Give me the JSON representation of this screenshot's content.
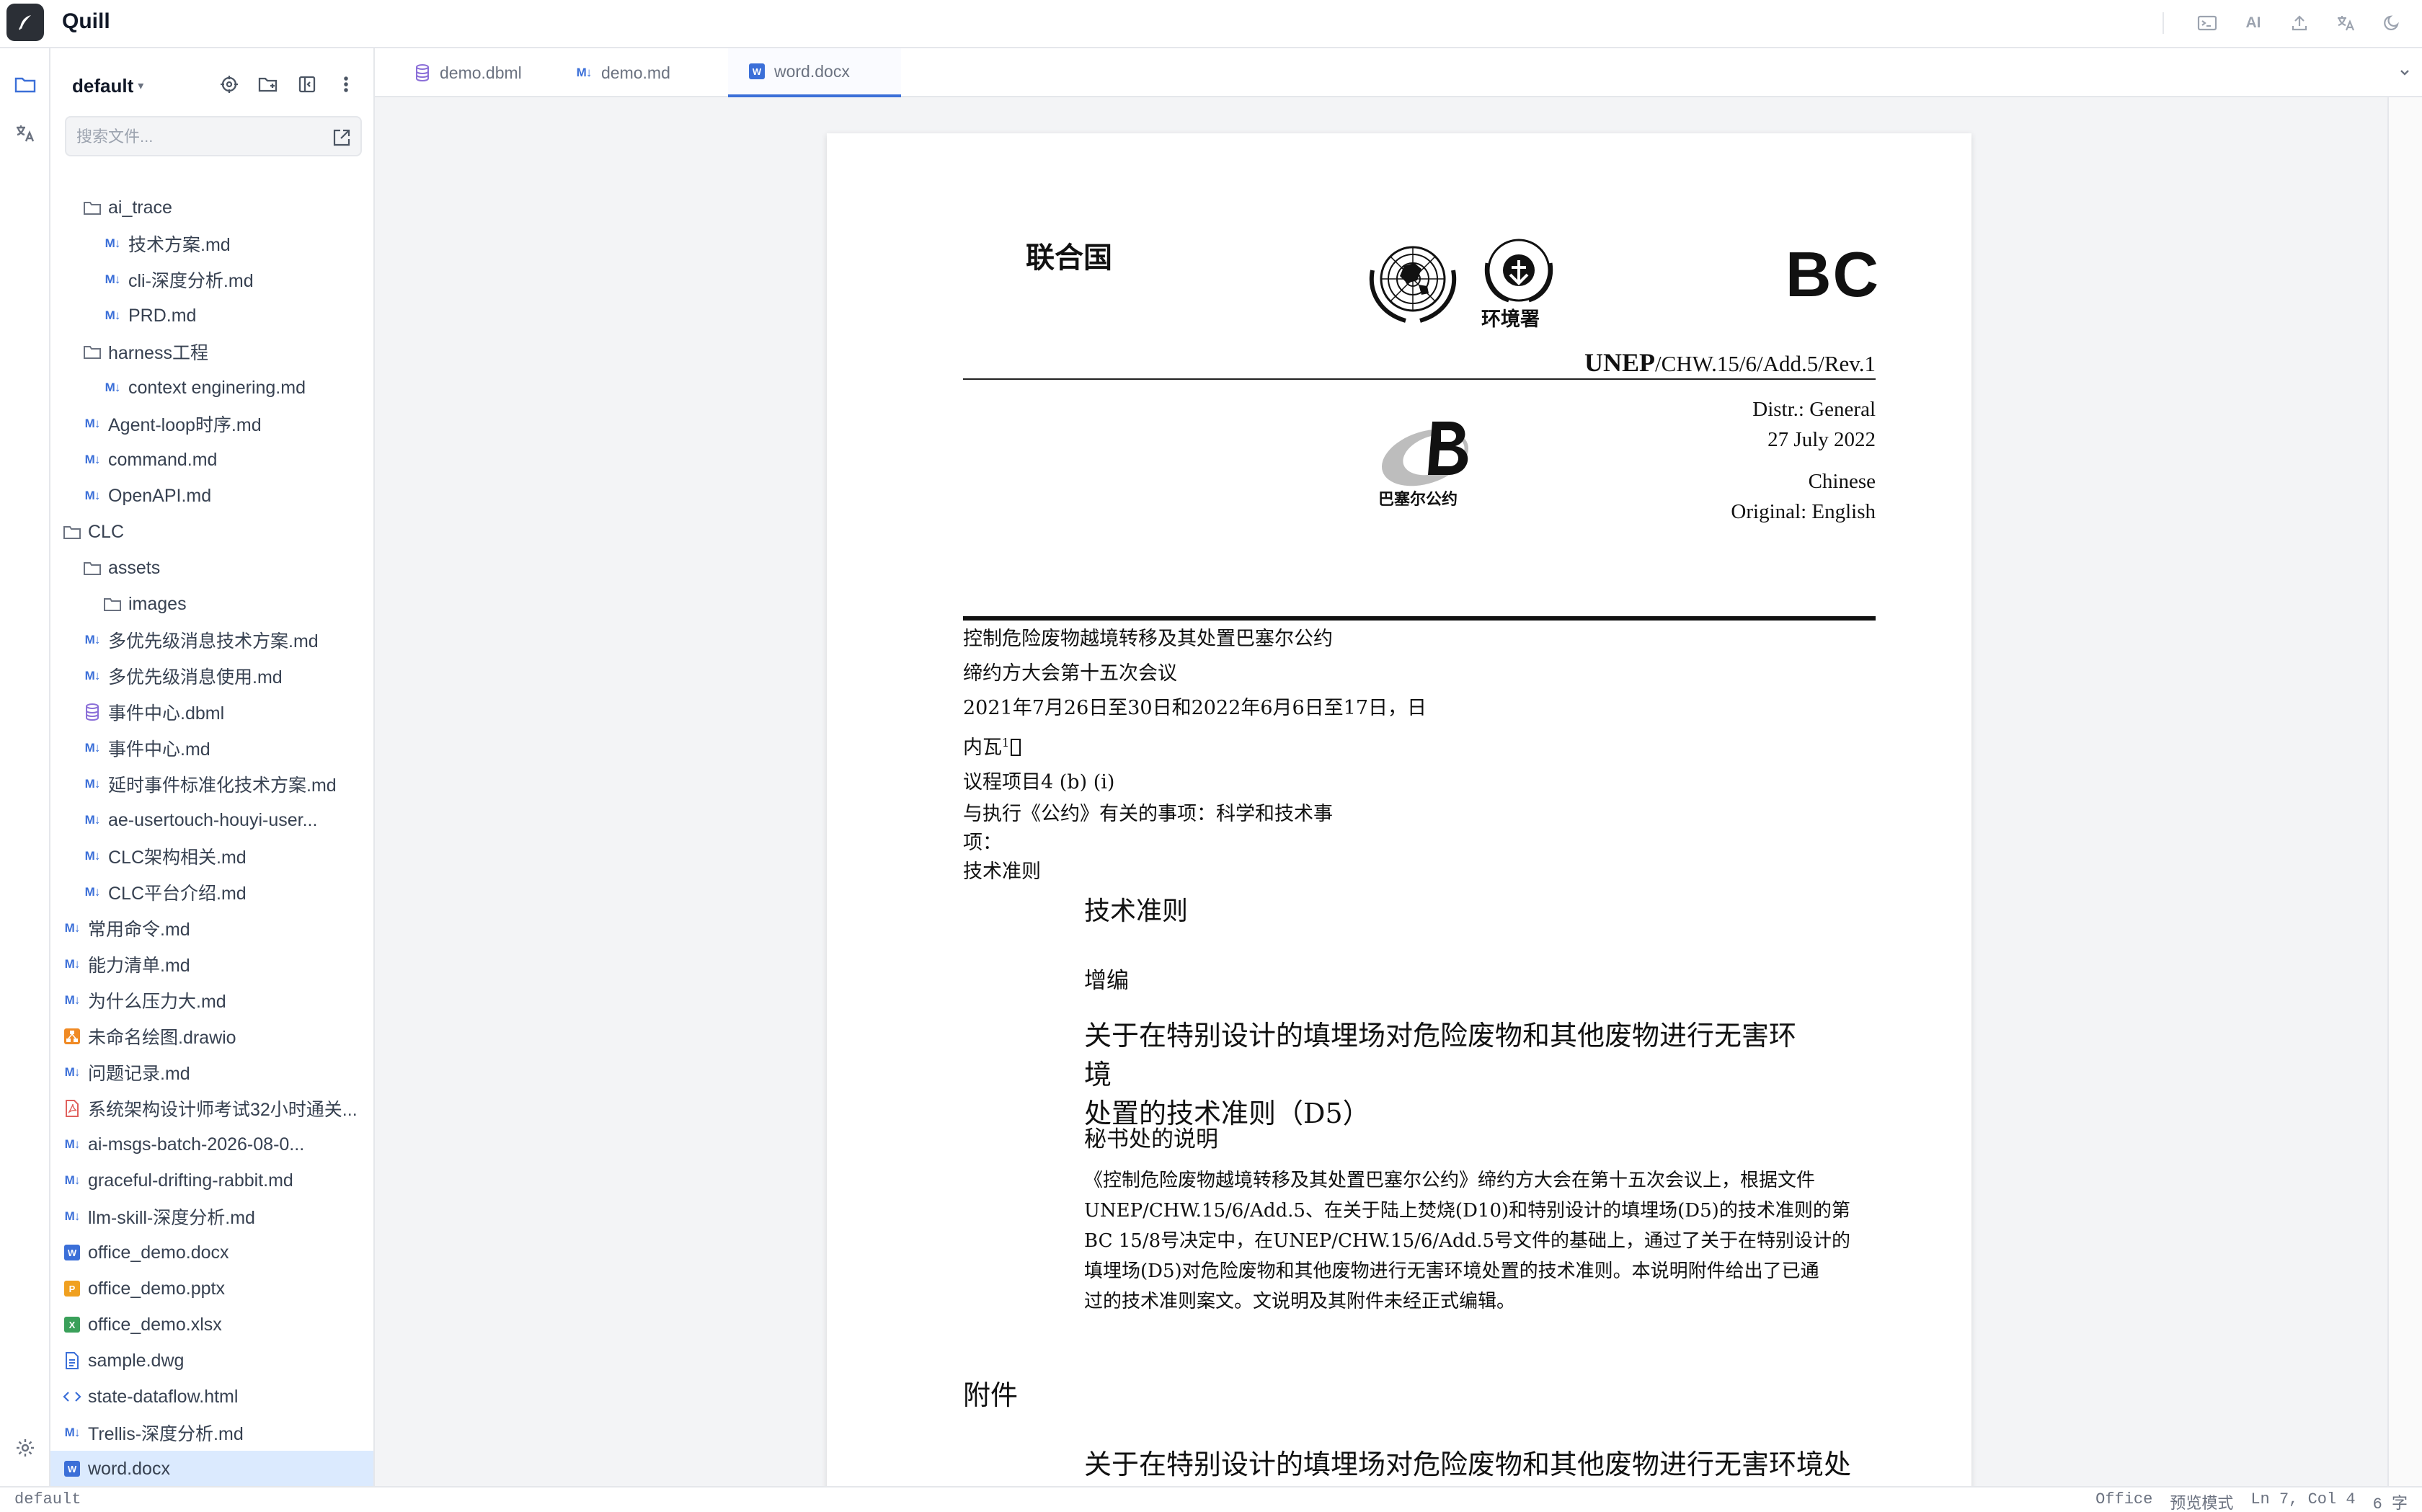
{
  "app": {
    "name": "Quill"
  },
  "topbar": {
    "ai_label": "AI",
    "icons": [
      "terminal-icon",
      "ai-icon",
      "upload-icon",
      "translate-icon",
      "moon-icon"
    ]
  },
  "rail": {
    "icons": [
      "folder-icon",
      "translate-icon",
      "settings-icon"
    ]
  },
  "sidebar": {
    "workspace": "default",
    "search_placeholder": "搜索文件...",
    "tree": [
      {
        "name": "ai_trace",
        "type": "folder",
        "depth": 2
      },
      {
        "name": "技术方案.md",
        "type": "md",
        "depth": 3
      },
      {
        "name": "cli-深度分析.md",
        "type": "md",
        "depth": 3
      },
      {
        "name": "PRD.md",
        "type": "md",
        "depth": 3
      },
      {
        "name": "harness工程",
        "type": "folder",
        "depth": 2
      },
      {
        "name": "context enginering.md",
        "type": "md",
        "depth": 3
      },
      {
        "name": "Agent-loop时序.md",
        "type": "md",
        "depth": 2
      },
      {
        "name": "command.md",
        "type": "md",
        "depth": 2
      },
      {
        "name": "OpenAPI.md",
        "type": "md",
        "depth": 2
      },
      {
        "name": "CLC",
        "type": "folder",
        "depth": 1
      },
      {
        "name": "assets",
        "type": "folder",
        "depth": 2
      },
      {
        "name": "images",
        "type": "folder",
        "depth": 3
      },
      {
        "name": "多优先级消息技术方案.md",
        "type": "md",
        "depth": 2
      },
      {
        "name": "多优先级消息使用.md",
        "type": "md",
        "depth": 2
      },
      {
        "name": "事件中心.dbml",
        "type": "dbml",
        "depth": 2
      },
      {
        "name": "事件中心.md",
        "type": "md",
        "depth": 2
      },
      {
        "name": "延时事件标准化技术方案.md",
        "type": "md",
        "depth": 2
      },
      {
        "name": "ae-usertouch-houyi-user...",
        "type": "md",
        "depth": 2
      },
      {
        "name": "CLC架构相关.md",
        "type": "md",
        "depth": 2
      },
      {
        "name": "CLC平台介绍.md",
        "type": "md",
        "depth": 2
      },
      {
        "name": "常用命令.md",
        "type": "md",
        "depth": 1
      },
      {
        "name": "能力清单.md",
        "type": "md",
        "depth": 1
      },
      {
        "name": "为什么压力大.md",
        "type": "md",
        "depth": 1
      },
      {
        "name": "未命名绘图.drawio",
        "type": "drawio",
        "depth": 1
      },
      {
        "name": "问题记录.md",
        "type": "md",
        "depth": 1
      },
      {
        "name": "系统架构设计师考试32小时通关...",
        "type": "pdf",
        "depth": 1
      },
      {
        "name": "ai-msgs-batch-2026-08-0...",
        "type": "md",
        "depth": 1
      },
      {
        "name": "graceful-drifting-rabbit.md",
        "type": "md",
        "depth": 1
      },
      {
        "name": "llm-skill-深度分析.md",
        "type": "md",
        "depth": 1
      },
      {
        "name": "office_demo.docx",
        "type": "docx",
        "depth": 1
      },
      {
        "name": "office_demo.pptx",
        "type": "pptx",
        "depth": 1
      },
      {
        "name": "office_demo.xlsx",
        "type": "xlsx",
        "depth": 1
      },
      {
        "name": "sample.dwg",
        "type": "dwg",
        "depth": 1
      },
      {
        "name": "state-dataflow.html",
        "type": "html",
        "depth": 1
      },
      {
        "name": "Trellis-深度分析.md",
        "type": "md",
        "depth": 1
      },
      {
        "name": "word.docx",
        "type": "docx",
        "depth": 1,
        "selected": true
      }
    ]
  },
  "tabs": [
    {
      "label": "demo.dbml",
      "type": "dbml",
      "active": false
    },
    {
      "label": "demo.md",
      "type": "md",
      "active": false
    },
    {
      "label": "word.docx",
      "type": "docx",
      "active": true
    }
  ],
  "document": {
    "org_cn": "联合国",
    "env_label": "环境署",
    "code": "BC",
    "symbol_prefix": "UNEP",
    "symbol_rest": "/CHW.15/6/Add.5/Rev.1",
    "distr": "Distr.: General",
    "date": "27 July 2022",
    "language": "Chinese",
    "original": "Original: English",
    "basel_label": "巴塞尔公约",
    "convention": "控制危险废物越境转移及其处置巴塞尔公约",
    "meeting": "缔约方大会第十五次会议",
    "dates_place": "2021年7月26日至30日和2022年6月6日至17日，日内瓦",
    "footnote_mark": "1",
    "agenda_item": "议程项目4 (b) (i)",
    "agenda_line1": "与执行《公约》有关的事项：科学和技术事",
    "agenda_line2": "项：",
    "agenda_line3": "技术准则",
    "heading_tech": "技术准则",
    "heading_add": "增编",
    "heading_main_1": "关于在特别设计的填埋场对危险废物和其他废物进行无害环境",
    "heading_main_2": "处置的技术准则（D5）",
    "heading_note": "秘书处的说明",
    "para_1": "《控制危险废物越境转移及其处置巴塞尔公约》缔约方大会在第十五次会议上，根据文件",
    "para_2": "UNEP/CHW.15/6/Add.5、在关于陆上焚烧(D10)和特别设计的填埋场(D5)的技术准则的第",
    "para_3": "BC 15/8号决定中，在UNEP/CHW.15/6/Add.5号文件的基础上，通过了关于在特别设计的",
    "para_4": "填埋场(D5)对危险废物和其他废物进行无害环境处置的技术准则。本说明附件给出了已通",
    "para_5": "过的技术准则案文。文说明及其附件未经正式编辑。",
    "annex_title": "附件",
    "annex_heading": "关于在特别设计的填埋场对危险废物和其他废物进行无害环境处置"
  },
  "statusbar": {
    "workspace": "default",
    "type": "Office",
    "mode": "预览模式",
    "position": "Ln 7, Col 4",
    "chars": "6 字"
  },
  "colors": {
    "accent": "#3b6fd8",
    "selected_row": "#dbeafe",
    "viewer_bg": "#f3f4f6"
  }
}
